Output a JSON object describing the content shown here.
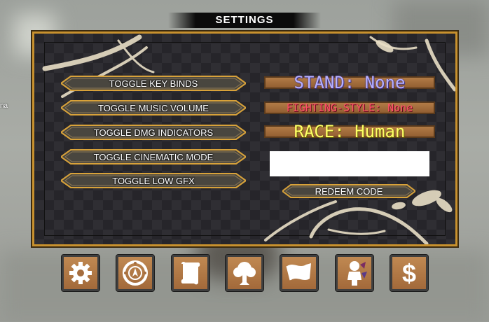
{
  "side_text": "na",
  "title": "SETTINGS",
  "toggles": [
    {
      "label": "TOGGLE KEY BINDS"
    },
    {
      "label": "TOGGLE MUSIC VOLUME"
    },
    {
      "label": "TOGGLE DMG INDICATORS"
    },
    {
      "label": "TOGGLE CINEMATIC MODE"
    },
    {
      "label": "TOGGLE LOW GFX"
    }
  ],
  "stats": {
    "stand": "STAND: None",
    "fighting_style": "FIGHTING-STYLE: None",
    "race": "RACE: Human"
  },
  "code_input": {
    "value": "",
    "placeholder": ""
  },
  "redeem_label": "REDEEM CODE",
  "bottom_icons": [
    "gear-icon",
    "compass-icon",
    "scroll-icon",
    "tree-icon",
    "flag-icon",
    "character-icon",
    "dollar-icon"
  ],
  "colors": {
    "frame_gold": "#c8912e",
    "button_tan": "#b17b46",
    "stand_text": "#b7b1ff",
    "fighting_text": "#ff4f68",
    "race_text": "#ffff66"
  }
}
